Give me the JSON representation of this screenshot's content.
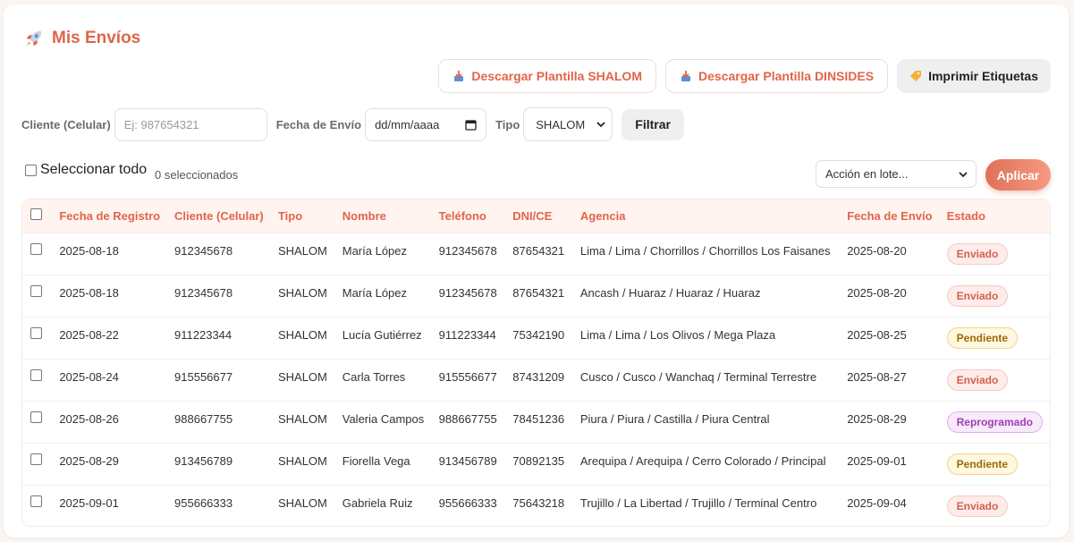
{
  "header": {
    "title": "Mis Envíos",
    "download_shalom": "Descargar Plantilla SHALOM",
    "download_dinsides": "Descargar Plantilla DINSIDES",
    "print_labels": "Imprimir Etiquetas"
  },
  "filters": {
    "client_label": "Cliente (Celular)",
    "client_placeholder": "Ej: 987654321",
    "date_label": "Fecha de Envío",
    "date_value": "dd/mm/aaaa",
    "type_label": "Tipo",
    "type_value": "SHALOM",
    "filter_button": "Filtrar"
  },
  "selection": {
    "select_all_label": "Seleccionar todo",
    "selected_count": "0 seleccionados",
    "bulk_action": "Acción en lote...",
    "apply_button": "Aplicar"
  },
  "table": {
    "columns": [
      "Fecha de Registro",
      "Cliente (Celular)",
      "Tipo",
      "Nombre",
      "Teléfono",
      "DNI/CE",
      "Agencia",
      "Fecha de Envío",
      "Estado"
    ],
    "rows": [
      {
        "registro": "2025-08-18",
        "cliente": "912345678",
        "tipo": "SHALOM",
        "nombre": "María López",
        "telefono": "912345678",
        "dni": "87654321",
        "agencia": "Lima / Lima / Chorrillos / Chorrillos Los Faisanes",
        "envio": "2025-08-20",
        "estado": "Enviado",
        "estado_class": "b-enviado"
      },
      {
        "registro": "2025-08-18",
        "cliente": "912345678",
        "tipo": "SHALOM",
        "nombre": "María López",
        "telefono": "912345678",
        "dni": "87654321",
        "agencia": "Ancash / Huaraz / Huaraz / Huaraz",
        "envio": "2025-08-20",
        "estado": "Enviado",
        "estado_class": "b-enviado"
      },
      {
        "registro": "2025-08-22",
        "cliente": "911223344",
        "tipo": "SHALOM",
        "nombre": "Lucía Gutiérrez",
        "telefono": "911223344",
        "dni": "75342190",
        "agencia": "Lima / Lima / Los Olivos / Mega Plaza",
        "envio": "2025-08-25",
        "estado": "Pendiente",
        "estado_class": "b-pendiente"
      },
      {
        "registro": "2025-08-24",
        "cliente": "915556677",
        "tipo": "SHALOM",
        "nombre": "Carla Torres",
        "telefono": "915556677",
        "dni": "87431209",
        "agencia": "Cusco / Cusco / Wanchaq / Terminal Terrestre",
        "envio": "2025-08-27",
        "estado": "Enviado",
        "estado_class": "b-enviado"
      },
      {
        "registro": "2025-08-26",
        "cliente": "988667755",
        "tipo": "SHALOM",
        "nombre": "Valeria Campos",
        "telefono": "988667755",
        "dni": "78451236",
        "agencia": "Piura / Piura / Castilla / Piura Central",
        "envio": "2025-08-29",
        "estado": "Reprogramado",
        "estado_class": "b-reprogramado"
      },
      {
        "registro": "2025-08-29",
        "cliente": "913456789",
        "tipo": "SHALOM",
        "nombre": "Fiorella Vega",
        "telefono": "913456789",
        "dni": "70892135",
        "agencia": "Arequipa / Arequipa / Cerro Colorado / Principal",
        "envio": "2025-09-01",
        "estado": "Pendiente",
        "estado_class": "b-pendiente"
      },
      {
        "registro": "2025-09-01",
        "cliente": "955666333",
        "tipo": "SHALOM",
        "nombre": "Gabriela Ruiz",
        "telefono": "955666333",
        "dni": "75643218",
        "agencia": "Trujillo / La Libertad / Trujillo / Terminal Centro",
        "envio": "2025-09-04",
        "estado": "Enviado",
        "estado_class": "b-enviado"
      }
    ]
  },
  "colors": {
    "accent": "#e0654a",
    "status_enviado": "#d0624c",
    "status_pendiente": "#9a6a00",
    "status_reprogramado": "#9d3fb3"
  },
  "icons": [
    "rocket-icon",
    "download-icon",
    "tag-icon",
    "calendar-icon",
    "chevron-down-icon",
    "checkbox-icon"
  ]
}
